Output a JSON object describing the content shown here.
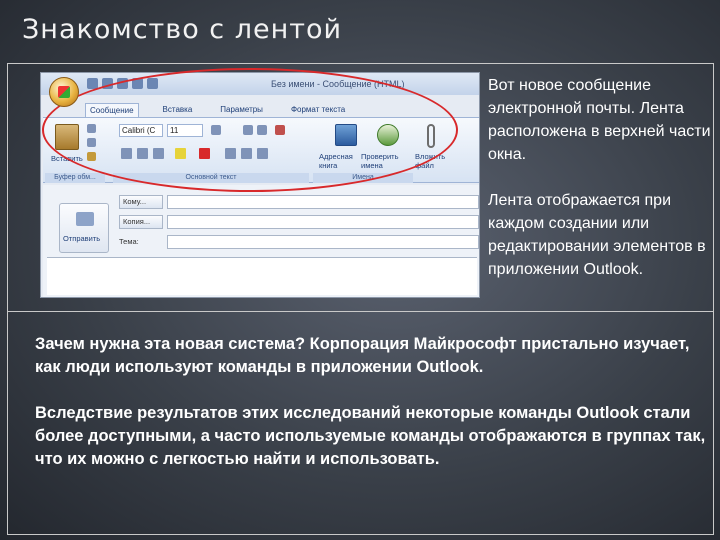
{
  "slide": {
    "title": "Знакомство с лентой",
    "side_paragraphs": [
      "Вот новое сообщение электронной почты. Лента расположена в верхней части окна.",
      "Лента отображается при каждом создании или редактировании элементов в приложении Outlook."
    ],
    "main_paragraphs": [
      "Зачем нужна эта новая система? Корпорация Майкрософт пристально изучает, как люди используют команды в приложении Outlook.",
      "Вследствие результатов этих исследований некоторые команды Outlook стали более доступными, а часто используемые команды отображаются в группах так, что их можно с легкостью найти и использовать."
    ]
  },
  "screenshot": {
    "window_title": "Без имени - Сообщение (HTML)",
    "tabs": [
      "Сообщение",
      "Вставка",
      "Параметры",
      "Формат текста"
    ],
    "active_tab": "Сообщение",
    "paste_label": "Вставить",
    "font_name": "Calibri (С",
    "font_size": "11",
    "clipboard_group": "Буфер обм...",
    "basic_text_group": "Основной текст",
    "names_group": "Имена",
    "address_book_label": "Адресная книга",
    "check_names_label": "Проверить имена",
    "attach_label": "Вложить файл",
    "send_label": "Отправить",
    "to_label": "Кому...",
    "cc_label": "Копия...",
    "subject_label": "Тема:"
  },
  "colors": {
    "highlight_ellipse": "#d8292b",
    "text": "#ffffff"
  }
}
